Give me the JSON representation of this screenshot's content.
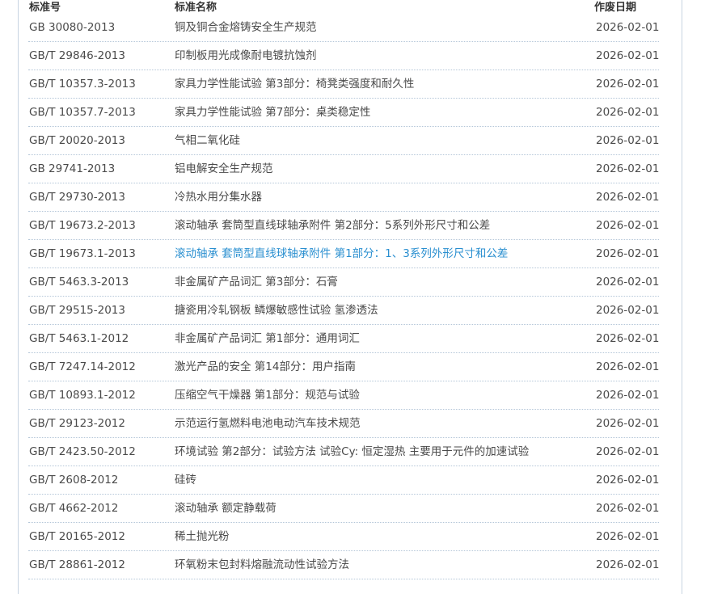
{
  "table": {
    "headers": {
      "code": "标准号",
      "name": "标准名称",
      "date": "作废日期"
    },
    "rows": [
      {
        "code": "GB 30080-2013",
        "name": "铜及铜合金熔铸安全生产规范",
        "date": "2026-02-01"
      },
      {
        "code": "GB/T 29846-2013",
        "name": "印制板用光成像耐电镀抗蚀剂",
        "date": "2026-02-01"
      },
      {
        "code": "GB/T 10357.3-2013",
        "name": "家具力学性能试验 第3部分：椅凳类强度和耐久性",
        "date": "2026-02-01"
      },
      {
        "code": "GB/T 10357.7-2013",
        "name": "家具力学性能试验 第7部分：桌类稳定性",
        "date": "2026-02-01"
      },
      {
        "code": "GB/T 20020-2013",
        "name": "气相二氧化硅",
        "date": "2026-02-01"
      },
      {
        "code": "GB 29741-2013",
        "name": "铝电解安全生产规范",
        "date": "2026-02-01"
      },
      {
        "code": "GB/T 29730-2013",
        "name": "冷热水用分集水器",
        "date": "2026-02-01"
      },
      {
        "code": "GB/T 19673.2-2013",
        "name": "滚动轴承 套筒型直线球轴承附件 第2部分：5系列外形尺寸和公差",
        "date": "2026-02-01"
      },
      {
        "code": "GB/T 19673.1-2013",
        "name": "滚动轴承 套筒型直线球轴承附件 第1部分：1、3系列外形尺寸和公差",
        "date": "2026-02-01",
        "highlight": true
      },
      {
        "code": "GB/T 5463.3-2013",
        "name": "非金属矿产品词汇 第3部分：石膏",
        "date": "2026-02-01"
      },
      {
        "code": "GB/T 29515-2013",
        "name": "搪瓷用冷轧钢板 鳞爆敏感性试验 氢渗透法",
        "date": "2026-02-01"
      },
      {
        "code": "GB/T 5463.1-2012",
        "name": "非金属矿产品词汇 第1部分：通用词汇",
        "date": "2026-02-01"
      },
      {
        "code": "GB/T 7247.14-2012",
        "name": "激光产品的安全 第14部分：用户指南",
        "date": "2026-02-01"
      },
      {
        "code": "GB/T 10893.1-2012",
        "name": "压缩空气干燥器 第1部分：规范与试验",
        "date": "2026-02-01"
      },
      {
        "code": "GB/T 29123-2012",
        "name": "示范运行氢燃料电池电动汽车技术规范",
        "date": "2026-02-01"
      },
      {
        "code": "GB/T 2423.50-2012",
        "name": "环境试验 第2部分：试验方法 试验Cy: 恒定湿热 主要用于元件的加速试验",
        "date": "2026-02-01"
      },
      {
        "code": "GB/T 2608-2012",
        "name": "硅砖",
        "date": "2026-02-01"
      },
      {
        "code": "GB/T 4662-2012",
        "name": "滚动轴承 额定静载荷",
        "date": "2026-02-01"
      },
      {
        "code": "GB/T 20165-2012",
        "name": "稀土抛光粉",
        "date": "2026-02-01"
      },
      {
        "code": "GB/T 28861-2012",
        "name": "环氧粉末包封料熔融流动性试验方法",
        "date": "2026-02-01"
      }
    ]
  },
  "colors": {
    "link_hover": "#2a8fd0",
    "text": "#4a4a4a",
    "border": "#c8d4e2",
    "row_divider": "#b4c6d8"
  }
}
